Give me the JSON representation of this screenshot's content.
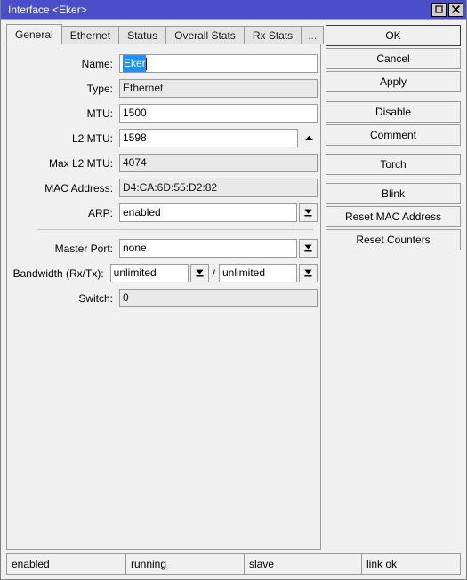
{
  "window": {
    "title": "Interface <Eker>",
    "titlebar_color": "#4a4ecb",
    "maximize_label": "maximize-icon",
    "close_label": "close-icon"
  },
  "tabs": [
    {
      "label": "General",
      "active": true
    },
    {
      "label": "Ethernet",
      "active": false
    },
    {
      "label": "Status",
      "active": false
    },
    {
      "label": "Overall Stats",
      "active": false
    },
    {
      "label": "Rx Stats",
      "active": false
    },
    {
      "label": "...",
      "active": false
    }
  ],
  "fields": {
    "name": {
      "label": "Name:",
      "value": "Eker",
      "selected": true
    },
    "type": {
      "label": "Type:",
      "value": "Ethernet",
      "readonly": true
    },
    "mtu": {
      "label": "MTU:",
      "value": "1500"
    },
    "l2mtu": {
      "label": "L2 MTU:",
      "value": "1598"
    },
    "max_l2mtu": {
      "label": "Max L2 MTU:",
      "value": "4074",
      "readonly": true
    },
    "mac_address": {
      "label": "MAC Address:",
      "value": "D4:CA:6D:55:D2:82",
      "readonly": true
    },
    "arp": {
      "label": "ARP:",
      "value": "enabled"
    },
    "master_port": {
      "label": "Master Port:",
      "value": "none"
    },
    "bandwidth": {
      "label": "Bandwidth (Rx/Tx):",
      "rx": "unlimited",
      "tx": "unlimited",
      "separator": "/"
    },
    "switch": {
      "label": "Switch:",
      "value": "0",
      "readonly": true
    }
  },
  "buttons": [
    {
      "label": "OK",
      "default": true
    },
    {
      "label": "Cancel",
      "default": false
    },
    {
      "label": "Apply",
      "default": false
    },
    {
      "label": "Disable",
      "default": false
    },
    {
      "label": "Comment",
      "default": false
    },
    {
      "label": "Torch",
      "default": false
    },
    {
      "label": "Blink",
      "default": false
    },
    {
      "label": "Reset MAC Address",
      "default": false
    },
    {
      "label": "Reset Counters",
      "default": false
    }
  ],
  "statusbar": {
    "cells": [
      "enabled",
      "running",
      "slave",
      "link ok"
    ]
  }
}
